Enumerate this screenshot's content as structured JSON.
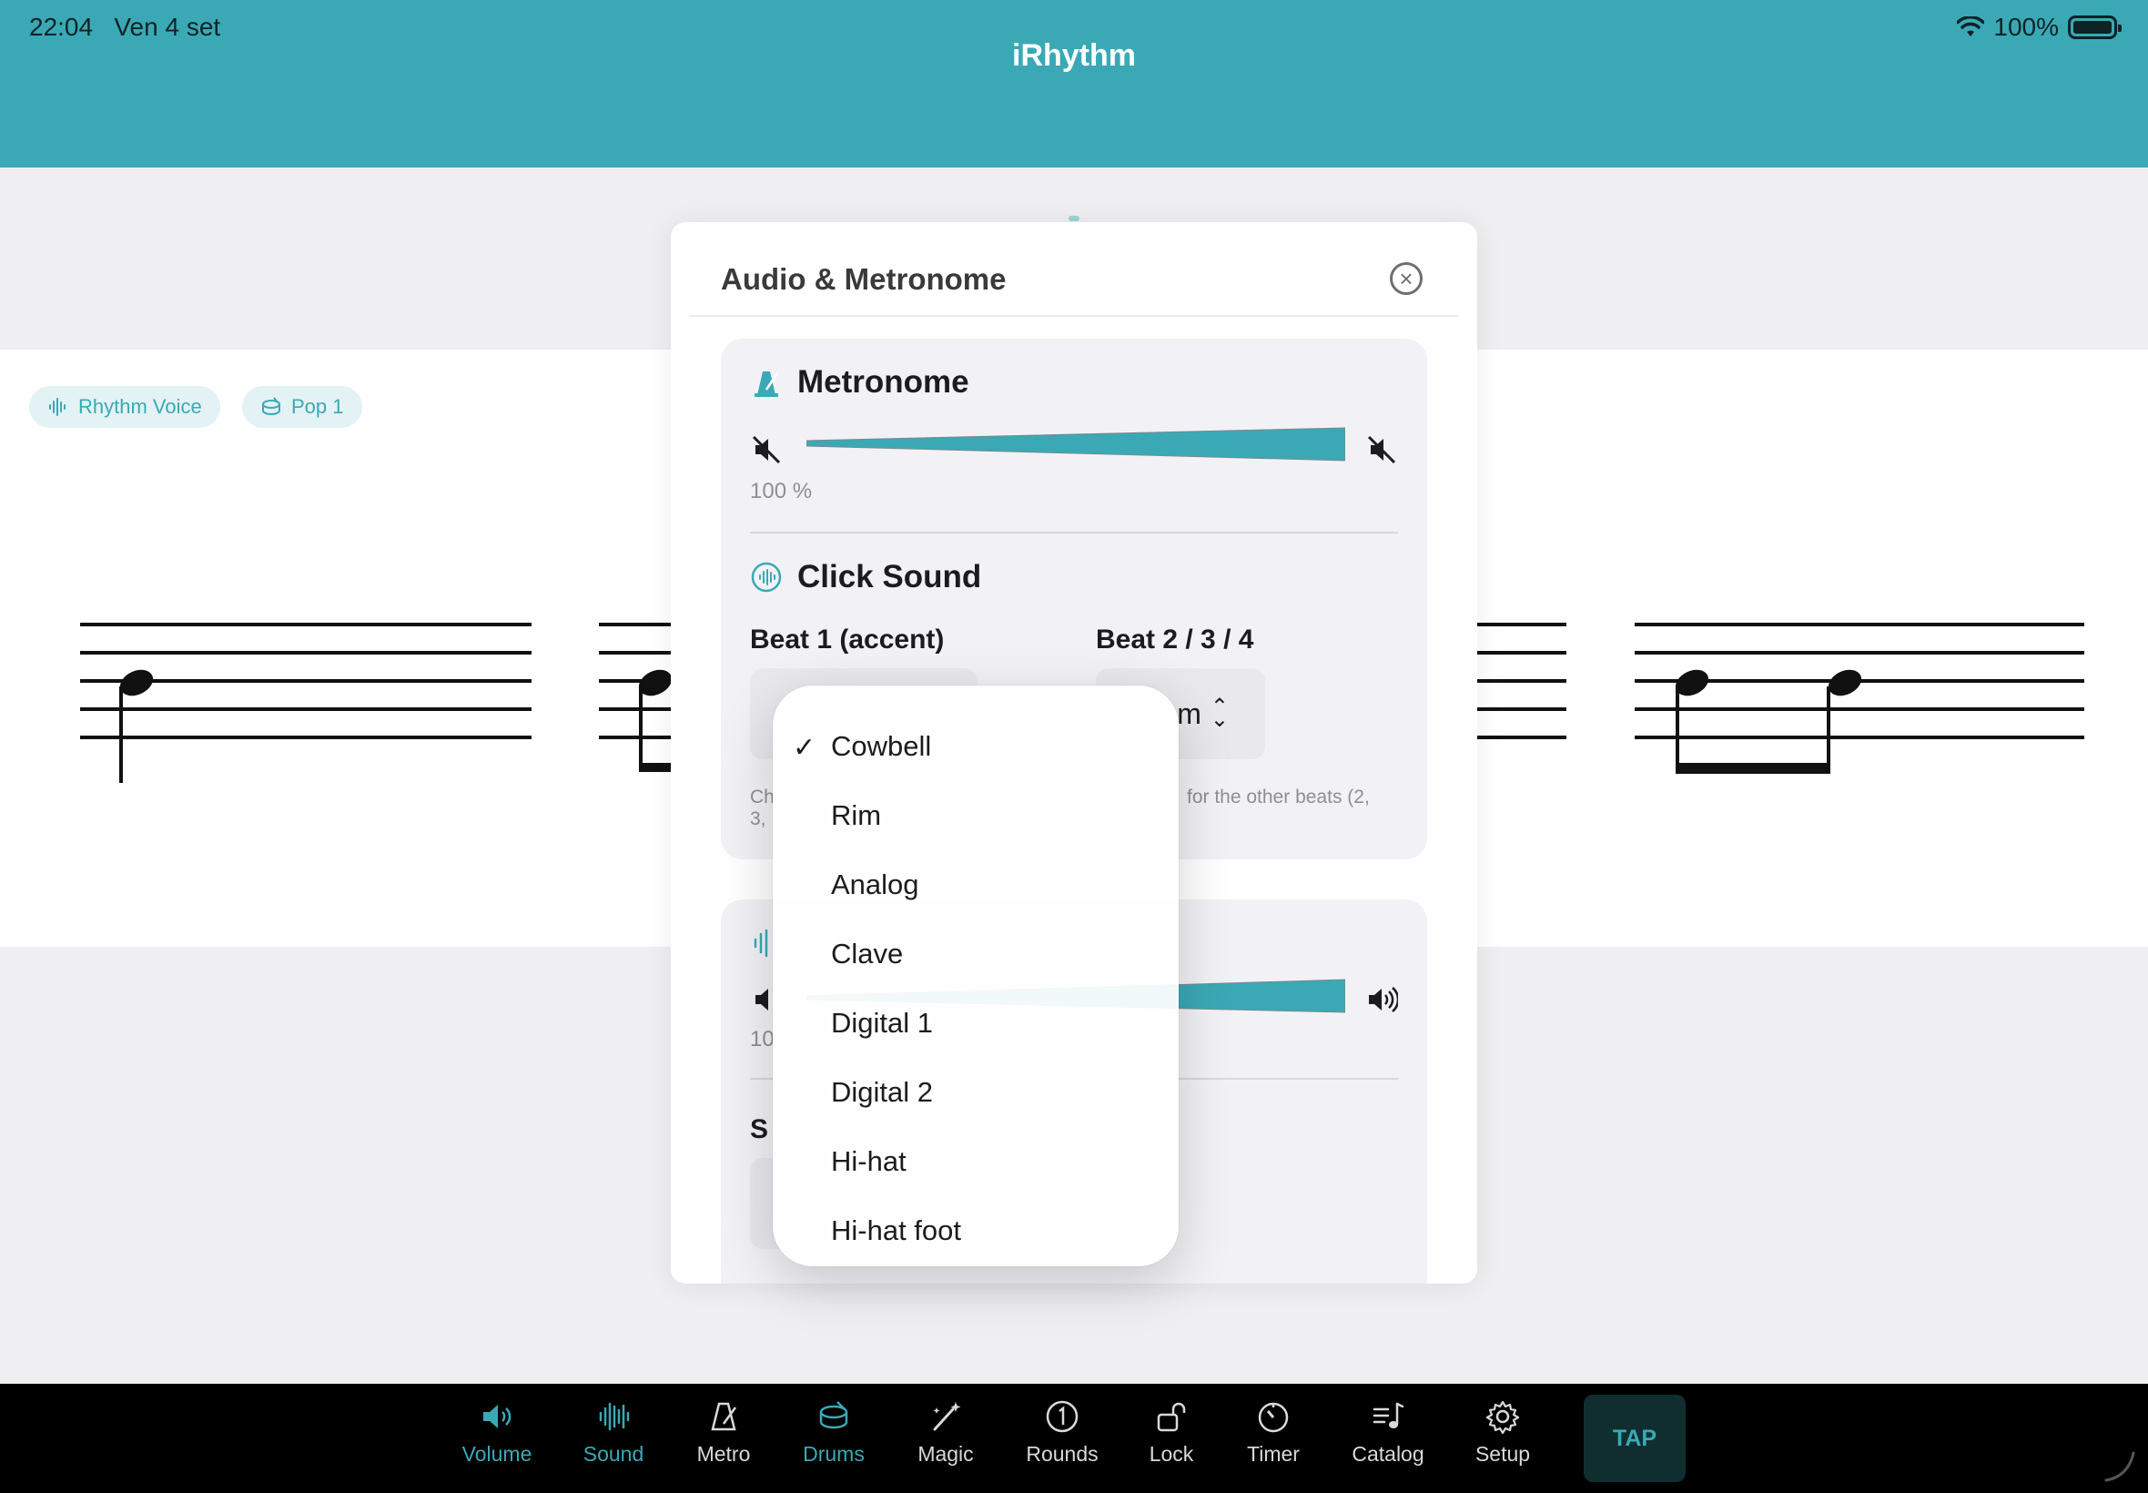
{
  "status_bar": {
    "time": "22:04",
    "date": "Ven 4 set",
    "battery": "100%",
    "battery_level": 1.0
  },
  "app": {
    "title": "iRhythm"
  },
  "chips": [
    {
      "label": "Rhythm Voice",
      "icon": "waveform-icon"
    },
    {
      "label": "Pop 1",
      "icon": "drum-icon"
    }
  ],
  "modal": {
    "title": "Audio & Metronome",
    "metronome": {
      "heading": "Metronome",
      "volume_label": "100 %",
      "volume_level": 1.0
    },
    "click_sound": {
      "heading": "Click Sound",
      "beat1_label": "Beat 1 (accent)",
      "beat234_label": "Beat 2 / 3 / 4",
      "beat234_value": "m",
      "help_left": "Ch",
      "help_left_2": "3,",
      "help_right": "for the other beats (2,"
    },
    "second_card": {
      "volume_label": "10",
      "section_partial": "S"
    }
  },
  "dropdown": {
    "selected": "Cowbell",
    "options": [
      "Cowbell",
      "Rim",
      "Analog",
      "Clave",
      "Digital 1",
      "Digital 2",
      "Hi-hat",
      "Hi-hat foot"
    ]
  },
  "tabbar": {
    "tabs": [
      {
        "label": "Volume",
        "icon": "speaker-icon",
        "active": true
      },
      {
        "label": "Sound",
        "icon": "waveform-icon",
        "active": true
      },
      {
        "label": "Metro",
        "icon": "metronome-icon",
        "active": false
      },
      {
        "label": "Drums",
        "icon": "drum-icon",
        "active": true
      },
      {
        "label": "Magic",
        "icon": "magic-wand-icon",
        "active": false
      },
      {
        "label": "Rounds",
        "icon": "number-one-circle-icon",
        "active": false
      },
      {
        "label": "Lock",
        "icon": "lock-open-icon",
        "active": false
      },
      {
        "label": "Timer",
        "icon": "timer-icon",
        "active": false
      },
      {
        "label": "Catalog",
        "icon": "music-list-icon",
        "active": false
      },
      {
        "label": "Setup",
        "icon": "gear-icon",
        "active": false
      }
    ],
    "tap_label": "TAP"
  },
  "colors": {
    "accent": "#3aa9b5",
    "header": "#3aa9b5",
    "tabbar": "#000000"
  }
}
